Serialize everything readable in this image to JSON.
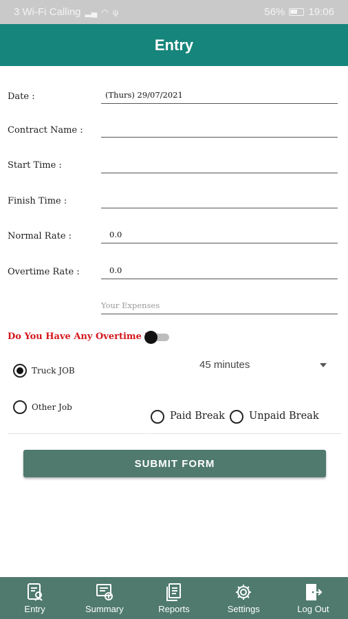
{
  "status_bar": {
    "carrier": "3 Wi-Fi Calling",
    "battery": "56%",
    "time": "19:06"
  },
  "header": {
    "title": "Entry"
  },
  "form": {
    "date_label": "Date :",
    "date_value": "(Thurs)  29/07/2021",
    "contract_label": "Contract Name :",
    "contract_value": "",
    "start_label": "Start Time :",
    "start_value": "",
    "finish_label": "Finish Time :",
    "finish_value": "",
    "normal_rate_label": "Normal Rate :",
    "normal_rate_value": "0.0",
    "overtime_rate_label": "Overtime Rate :",
    "overtime_rate_value": "0.0",
    "expenses_placeholder": "Your Expenses",
    "overtime_question": "Do You Have Any Overtime ?",
    "overtime_enabled": false,
    "job_options": [
      "Truck JOB",
      "Other Job"
    ],
    "job_selected": "Truck JOB",
    "break_duration": "45 minutes",
    "break_options": [
      "Paid Break",
      "Unpaid Break"
    ],
    "submit_label": "SUBMIT FORM"
  },
  "bottom_nav": {
    "items": [
      {
        "label": "Entry",
        "icon": "entry-icon"
      },
      {
        "label": "Summary",
        "icon": "summary-icon"
      },
      {
        "label": "Reports",
        "icon": "reports-icon"
      },
      {
        "label": "Settings",
        "icon": "settings-icon"
      },
      {
        "label": "Log Out",
        "icon": "logout-icon"
      }
    ]
  },
  "colors": {
    "header": "#16857b",
    "nav": "#4f7a6d",
    "overtime_label": "#d4161d"
  }
}
